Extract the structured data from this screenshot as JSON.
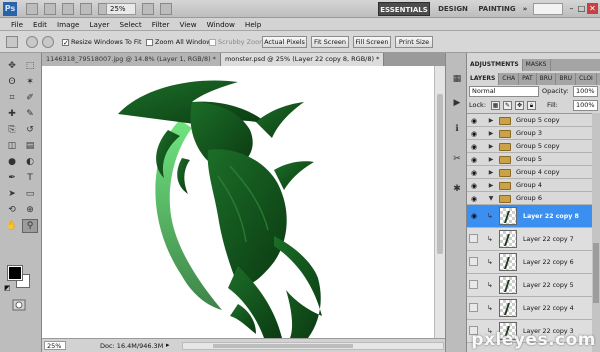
{
  "app": {
    "logo": "Ps",
    "zoom": "25%",
    "workspaces": [
      "ESSENTIALS",
      "DESIGN",
      "PAINTING",
      "»"
    ],
    "window_controls": [
      "–",
      "□",
      "✕"
    ]
  },
  "menu": [
    "File",
    "Edit",
    "Image",
    "Layer",
    "Select",
    "Filter",
    "View",
    "Window",
    "Help"
  ],
  "options": {
    "resize_windows": {
      "label": "Resize Windows To Fit",
      "checked": true
    },
    "zoom_all": {
      "label": "Zoom All Windows",
      "checked": false
    },
    "scrubby": {
      "label": "Scrubby Zoom",
      "checked": false
    },
    "buttons": [
      "Actual Pixels",
      "Fit Screen",
      "Fill Screen",
      "Print Size"
    ]
  },
  "tools": {
    "icons": [
      "move-icon",
      "marquee-icon",
      "lasso-icon",
      "magic-wand-icon",
      "crop-icon",
      "eyedropper-icon",
      "healing-icon",
      "brush-icon",
      "stamp-icon",
      "history-brush-icon",
      "eraser-icon",
      "gradient-icon",
      "blur-icon",
      "dodge-icon",
      "pen-icon",
      "type-icon",
      "path-select-icon",
      "shape-icon",
      "3d-rotate-icon",
      "3d-orbit-icon",
      "hand-icon",
      "zoom-icon"
    ],
    "glyphs": [
      "✥",
      "⬚",
      "ʘ",
      "✶",
      "⌗",
      "✐",
      "✚",
      "✎",
      "⎘",
      "↺",
      "◫",
      "▤",
      "●",
      "◐",
      "✒",
      "T",
      "➤",
      "▭",
      "⟲",
      "⊕",
      "✋",
      "⚲"
    ],
    "active_index": 21
  },
  "tabs": [
    "1146318_79518007.jpg @ 14.8% (Layer 1, RGB/8) *",
    "monster.psd @ 25% (Layer 22 copy 8, RGB/8) *"
  ],
  "active_tab": 1,
  "status": {
    "zoom": "25%",
    "doc": "Doc: 16.4M/946.3M"
  },
  "panels": {
    "top_tabs": [
      "ADJUSTMENTS",
      "MASKS"
    ],
    "layer_tabs": [
      "LAYERS",
      "CHA",
      "PAT",
      "BRU",
      "BRU",
      "CLOI"
    ],
    "blend_mode": "Normal",
    "opacity_label": "Opacity:",
    "opacity": "100%",
    "lock_label": "Lock:",
    "fill_label": "Fill:",
    "fill": "100%"
  },
  "groups": [
    {
      "name": "Group 5 copy",
      "open": false
    },
    {
      "name": "Group 3",
      "open": false
    },
    {
      "name": "Group 5 copy",
      "open": false
    },
    {
      "name": "Group 5",
      "open": false
    },
    {
      "name": "Group 4 copy",
      "open": false
    },
    {
      "name": "Group 4",
      "open": false
    },
    {
      "name": "Group 6",
      "open": true
    }
  ],
  "layers": [
    {
      "name": "Layer 22 copy 8",
      "selected": true
    },
    {
      "name": "Layer 22 copy 7",
      "selected": false
    },
    {
      "name": "Layer 22 copy 6",
      "selected": false
    },
    {
      "name": "Layer 22 copy 5",
      "selected": false
    },
    {
      "name": "Layer 22 copy 4",
      "selected": false
    },
    {
      "name": "Layer 22 copy 3",
      "selected": false
    }
  ],
  "watermark": "pxleyes.com",
  "colors": {
    "accent": "#3b8ff0",
    "workspace_active": "#4d4d4d",
    "monster_dark": "#0b3a12",
    "monster_mid": "#1c6e28",
    "monster_glow": "#57e06a"
  }
}
